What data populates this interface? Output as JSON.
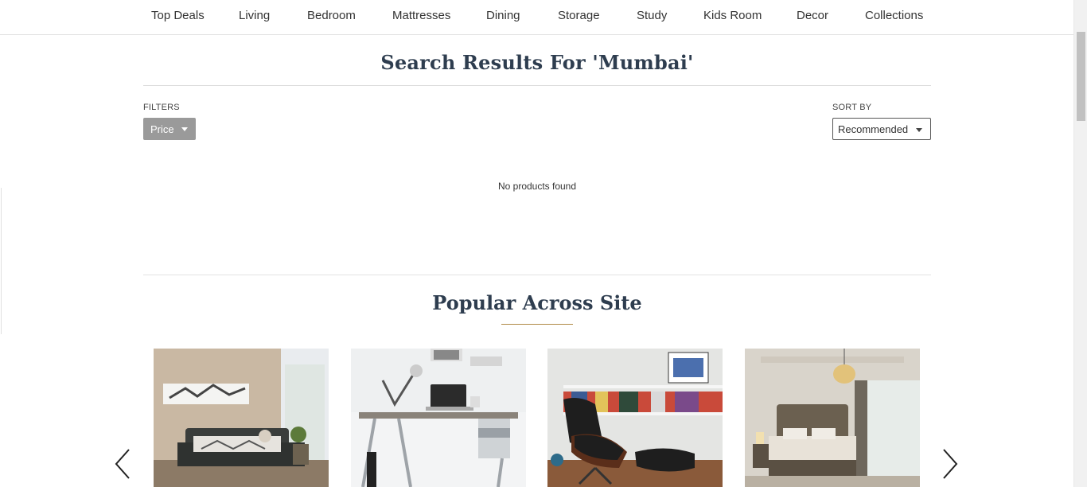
{
  "nav": {
    "items": [
      "Top Deals",
      "Living",
      "Bedroom",
      "Mattresses",
      "Dining",
      "Storage",
      "Study",
      "Kids Room",
      "Decor",
      "Collections"
    ]
  },
  "search": {
    "title": "Search Results For 'Mumbai'"
  },
  "filters": {
    "label": "FILTERS",
    "price_button": "Price"
  },
  "sort": {
    "label": "SORT BY",
    "selected": "Recommended"
  },
  "results": {
    "empty_message": "No products found"
  },
  "popular": {
    "title": "Popular Across Site",
    "products": [
      {
        "icon": "bed-image"
      },
      {
        "icon": "study-desk-image"
      },
      {
        "icon": "lounge-chair-image"
      },
      {
        "icon": "bedroom-image"
      }
    ]
  },
  "colors": {
    "heading": "#2e3d4f",
    "accent_gold": "#b08a47",
    "filter_button": "#9a9a9a"
  }
}
